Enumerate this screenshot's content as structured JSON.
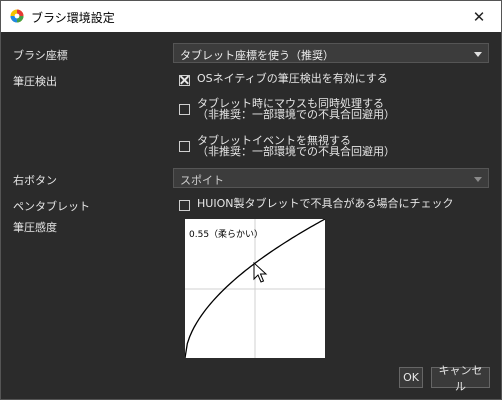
{
  "window": {
    "title": "ブラシ環境設定"
  },
  "brush_coord": {
    "label": "ブラシ座標",
    "value": "タブレット座標を使う（推奨）"
  },
  "pressure_detect": {
    "label": "筆圧検出",
    "options": [
      {
        "line1": "OSネイティブの筆圧検出を有効にする",
        "line2": "",
        "checked": true
      },
      {
        "line1": "タブレット時にマウスも同時処理する",
        "line2": "（非推奨：一部環境での不具合回避用）",
        "checked": false
      },
      {
        "line1": "タブレットイベントを無視する",
        "line2": "（非推奨：一部環境での不具合回避用）",
        "checked": false
      }
    ]
  },
  "right_button": {
    "label": "右ボタン",
    "value": "スポイト"
  },
  "pen_tablet": {
    "label": "ペンタブレット",
    "option": "HUION製タブレットで不具合がある場合にチェック",
    "checked": false
  },
  "pressure_sensitivity": {
    "label": "筆圧感度",
    "value_text": "0.55（柔らかい）",
    "value": 0.55
  },
  "buttons": {
    "ok": "OK",
    "cancel": "キャンセル"
  },
  "icons": {
    "app": "medibang-app-icon",
    "close": "close-icon",
    "cursor": "mouse-pointer-icon"
  }
}
